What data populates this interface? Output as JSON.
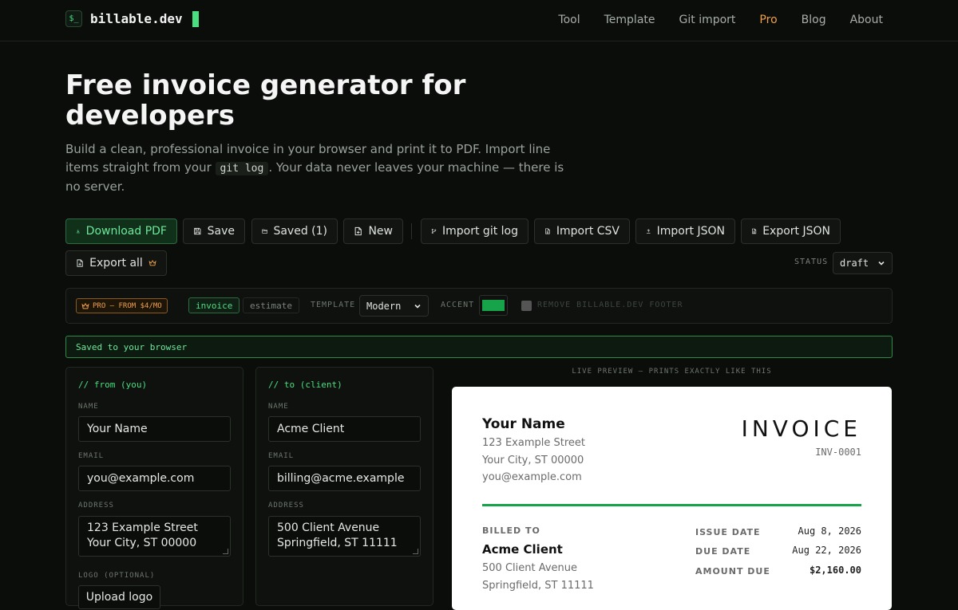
{
  "brand": {
    "icon": "$_",
    "name": "billable.dev"
  },
  "nav": [
    "Tool",
    "Template",
    "Git import",
    "Pro",
    "Blog",
    "About"
  ],
  "hero": {
    "title": "Free invoice generator for developers",
    "lede_before": "Build a clean, professional invoice in your browser and print it to PDF. Import line items straight from your ",
    "lede_code": "git log",
    "lede_after": ". Your data never leaves your machine — there is no server."
  },
  "toolbar": {
    "download": "Download PDF",
    "save": "Save",
    "saved": "Saved (1)",
    "new": "New",
    "import_git": "Import git log",
    "import_csv": "Import CSV",
    "import_json": "Import JSON",
    "export_json": "Export JSON",
    "export_all": "Export all"
  },
  "status": {
    "label": "STATUS",
    "value": "draft"
  },
  "pro": {
    "badge": "PRO — FROM $4/MO",
    "doc_types": [
      "invoice",
      "estimate"
    ],
    "template_label": "TEMPLATE",
    "template_value": "Modern",
    "accent_label": "ACCENT",
    "accent_color": "#16a34a",
    "footer_label": "REMOVE BILLABLE.DEV FOOTER"
  },
  "notice": "Saved to your browser",
  "from": {
    "heading": "// from (you)",
    "name_label": "NAME",
    "name": "Your Name",
    "email_label": "EMAIL",
    "email": "you@example.com",
    "address_label": "ADDRESS",
    "address_1": "123 Example Street",
    "address_2": "Your City, ST 00000",
    "logo_label": "LOGO (OPTIONAL)",
    "logo_button": "Upload logo"
  },
  "to": {
    "heading": "// to (client)",
    "name_label": "NAME",
    "name": "Acme Client",
    "email_label": "EMAIL",
    "email": "billing@acme.example",
    "address_label": "ADDRESS",
    "address_1": "500 Client Avenue",
    "address_2": "Springfield, ST 11111"
  },
  "preview": {
    "caption": "LIVE PREVIEW — PRINTS EXACTLY LIKE THIS",
    "from_name": "Your Name",
    "from_addr_1": "123 Example Street",
    "from_addr_2": "Your City, ST 00000",
    "from_email": "you@example.com",
    "title": "INVOICE",
    "number": "INV-0001",
    "billed_to_label": "BILLED TO",
    "client_name": "Acme Client",
    "client_addr_1": "500 Client Avenue",
    "client_addr_2": "Springfield, ST 11111",
    "issue_label": "ISSUE DATE",
    "issue": "Aug 8, 2026",
    "due_label": "DUE DATE",
    "due": "Aug 22, 2026",
    "amount_label": "AMOUNT DUE",
    "amount": "$2,160.00"
  }
}
